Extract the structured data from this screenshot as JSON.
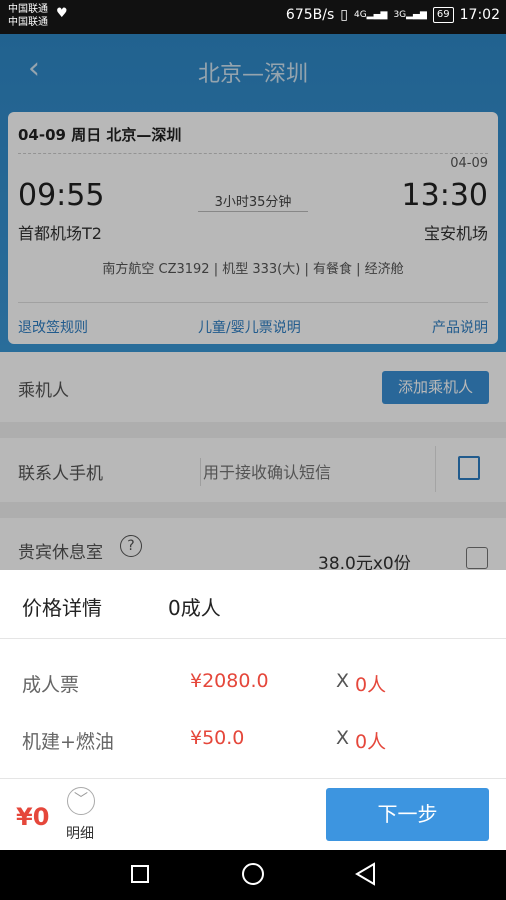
{
  "status_bar": {
    "carrier1": "中国联通",
    "carrier2": "中国联通",
    "speed": "675B/s",
    "signal1": "4G",
    "signal2": "3G",
    "battery": "69",
    "time": "17:02"
  },
  "header": {
    "title": "北京—深圳"
  },
  "flight": {
    "date_route": "04-09 周日  北京—深圳",
    "arrival_date": "04-09",
    "depart_time": "09:55",
    "arrive_time": "13:30",
    "duration": "3小时35分钟",
    "depart_airport": "首都机场T2",
    "arrive_airport": "宝安机场",
    "info": "南方航空 CZ3192 | 机型 333(大) | 有餐食 | 经济舱",
    "links": {
      "refund": "退改签规则",
      "child": "儿童/婴儿票说明",
      "product": "产品说明"
    }
  },
  "form": {
    "passenger_label": "乘机人",
    "add_passenger": "添加乘机人",
    "phone_label": "联系人手机",
    "phone_placeholder": "用于接收确认短信",
    "lounge_label": "贵宾休息室",
    "lounge_price": "38.0元x0份"
  },
  "price_panel": {
    "title": "价格详情",
    "count": "0成人",
    "items": [
      {
        "name": "成人票",
        "price": "¥2080.0",
        "x": "X",
        "qty": "0人"
      },
      {
        "name": "机建+燃油",
        "price": "¥50.0",
        "x": "X",
        "qty": "0人"
      }
    ]
  },
  "bottom": {
    "total": "¥0",
    "detail": "明细",
    "next": "下一步"
  },
  "colors": {
    "accent": "#3d95e0",
    "price_red": "#e5473b",
    "header_blue": "#2f88c7"
  }
}
